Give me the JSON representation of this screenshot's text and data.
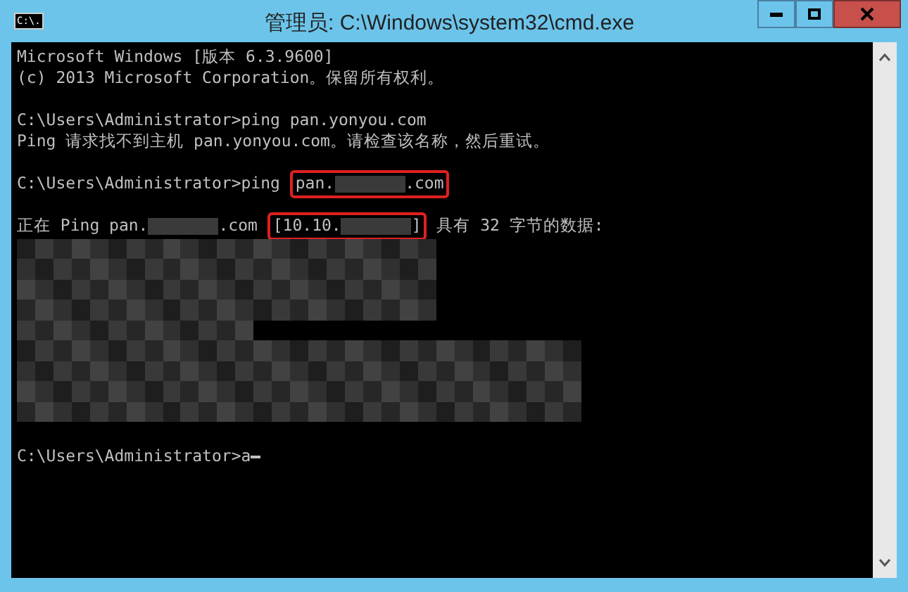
{
  "window": {
    "title": "管理员: C:\\Windows\\system32\\cmd.exe",
    "icon_text": "C:\\."
  },
  "console": {
    "blocks": [
      {
        "lines": [
          {
            "parts": [
              {
                "kind": "text",
                "text": "Microsoft Windows [版本 6.3.9600]"
              }
            ]
          },
          {
            "parts": [
              {
                "kind": "text",
                "text": "(c) 2013 Microsoft Corporation。保留所有权利。"
              }
            ]
          }
        ]
      },
      {
        "lines": [
          {
            "parts": [
              {
                "kind": "text",
                "text": "C:\\Users\\Administrator>ping pan.yonyou.com"
              }
            ]
          },
          {
            "parts": [
              {
                "kind": "text",
                "text": "Ping 请求找不到主机 pan.yonyou.com。请检查该名称，然后重试。"
              }
            ]
          }
        ]
      },
      {
        "lines": [
          {
            "parts": [
              {
                "kind": "text",
                "text": "C:\\Users\\Administrator>ping "
              },
              {
                "kind": "boxed",
                "parts": [
                  {
                    "kind": "text",
                    "text": "pan."
                  },
                  {
                    "kind": "redacted"
                  },
                  {
                    "kind": "text",
                    "text": ".com"
                  }
                ]
              }
            ]
          }
        ]
      },
      {
        "lines": [
          {
            "parts": [
              {
                "kind": "text",
                "text": "正在 Ping pan."
              },
              {
                "kind": "redacted"
              },
              {
                "kind": "text",
                "text": ".com "
              },
              {
                "kind": "boxed",
                "parts": [
                  {
                    "kind": "text",
                    "text": "[10.10."
                  },
                  {
                    "kind": "redacted"
                  },
                  {
                    "kind": "text",
                    "text": "]"
                  }
                ]
              },
              {
                "kind": "text",
                "text": " 具有 32 字节的数据:"
              }
            ]
          },
          {
            "parts": [
              {
                "kind": "blur"
              }
            ]
          }
        ]
      },
      {
        "lines": [
          {
            "parts": [
              {
                "kind": "text",
                "text": "C:\\Users\\Administrator>a"
              },
              {
                "kind": "cursor"
              }
            ]
          }
        ]
      }
    ]
  }
}
